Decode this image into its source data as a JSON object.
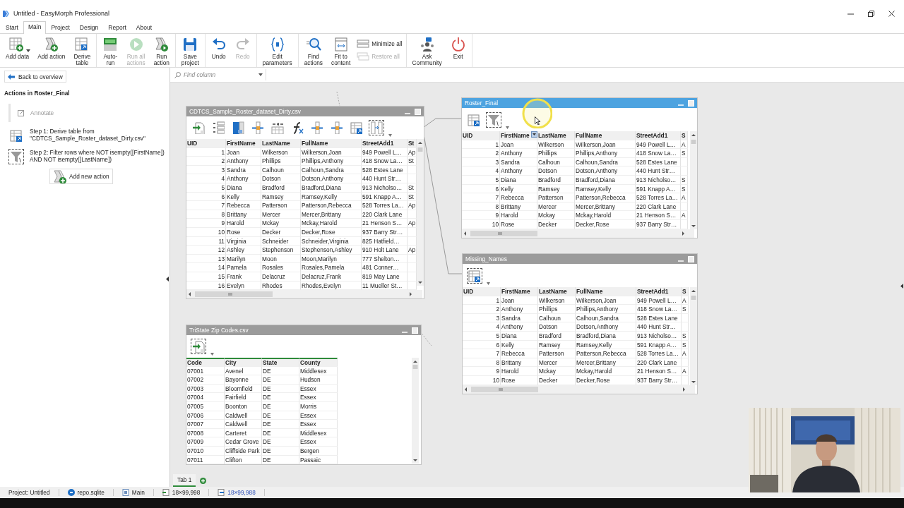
{
  "window": {
    "title": "Untitled - EasyMorph Professional"
  },
  "menu_tabs": [
    {
      "label": "Start",
      "selected": false
    },
    {
      "label": "Main",
      "selected": true
    },
    {
      "label": "Project",
      "selected": false
    },
    {
      "label": "Design",
      "selected": false
    },
    {
      "label": "Report",
      "selected": false
    },
    {
      "label": "About",
      "selected": false
    }
  ],
  "ribbon": {
    "groups": [
      {
        "buttons": [
          {
            "kind": "large",
            "label": "Add data",
            "disabled": false,
            "dropdown": true
          },
          {
            "kind": "large",
            "label": "Add action",
            "disabled": false,
            "dropdown": false
          },
          {
            "kind": "large",
            "label": "Derive\ntable",
            "disabled": false,
            "dropdown": false
          }
        ]
      },
      {
        "buttons": [
          {
            "kind": "large",
            "label": "Auto-\nrun",
            "disabled": false,
            "dropdown": false
          },
          {
            "kind": "large",
            "label": "Run all\nactions",
            "disabled": true,
            "dropdown": false
          },
          {
            "kind": "large",
            "label": "Run\naction",
            "disabled": false,
            "dropdown": false
          }
        ]
      },
      {
        "buttons": [
          {
            "kind": "large",
            "label": "Save\nproject",
            "disabled": false,
            "dropdown": false
          }
        ]
      },
      {
        "buttons": [
          {
            "kind": "large",
            "label": "Undo",
            "disabled": false,
            "dropdown": false
          },
          {
            "kind": "large",
            "label": "Redo",
            "disabled": true,
            "dropdown": false
          }
        ]
      },
      {
        "buttons": [
          {
            "kind": "large",
            "label": "Edit\nparameters",
            "disabled": false,
            "dropdown": false
          }
        ]
      },
      {
        "buttons": [
          {
            "kind": "large",
            "label": "Find\nactions",
            "disabled": false,
            "dropdown": false
          },
          {
            "kind": "large",
            "label": "Fit to\ncontent",
            "disabled": false,
            "dropdown": false
          },
          {
            "kind": "small",
            "label": "Minimize all",
            "disabled": false,
            "dropdown": false
          },
          {
            "kind": "small",
            "label": "Restore all",
            "disabled": true,
            "dropdown": false
          }
        ]
      },
      {
        "buttons": [
          {
            "kind": "large",
            "label": "Ask\nCommunity",
            "disabled": false,
            "dropdown": false
          },
          {
            "kind": "large",
            "label": "Exit",
            "disabled": false,
            "dropdown": false
          }
        ]
      }
    ]
  },
  "find_column": {
    "placeholder": "Find column"
  },
  "sidebar": {
    "back_button": "Back to overview",
    "heading": "Actions in Roster_Final",
    "annotate": {
      "label": "Annotate",
      "disabled": true
    },
    "steps": [
      {
        "kind": "derive",
        "text": "Step 1: Derive table from\n\"CDTCS_Sample_Roster_dataset_Dirty.csv\"",
        "selected": false
      },
      {
        "kind": "filter",
        "text": "Step 2: Filter rows where NOT isempty([FirstName])\nAND NOT isempty([LastName])",
        "selected": true
      }
    ],
    "add_button": "Add new action"
  },
  "tables": [
    {
      "title": "CDTCS_Sample_Roster_dataset_Dirty.csv",
      "selected": false,
      "actions": [
        {
          "kind": "import",
          "selected": false
        },
        {
          "kind": "enumerate",
          "selected": false
        },
        {
          "kind": "column",
          "selected": false
        },
        {
          "kind": "insert",
          "selected": false
        },
        {
          "kind": "merge",
          "selected": false
        },
        {
          "kind": "formula",
          "selected": false
        },
        {
          "kind": "insert",
          "selected": false
        },
        {
          "kind": "insert",
          "selected": false
        },
        {
          "kind": "derive",
          "selected": false
        },
        {
          "kind": "select",
          "selected": true
        }
      ],
      "columns": [
        "UID",
        "FirstName",
        "LastName",
        "FullName",
        "StreetAdd1",
        "St"
      ],
      "rows": [
        [
          "1",
          "Joan",
          "Wilkerson",
          "Wilkerson,Joan",
          "949 Powell L…",
          "Ap"
        ],
        [
          "2",
          "Anthony",
          "Phillips",
          "Phillips,Anthony",
          "418 Snow La…",
          "St"
        ],
        [
          "3",
          "Sandra",
          "Calhoun",
          "Calhoun,Sandra",
          "528 Estes Lane",
          null
        ],
        [
          "4",
          "Anthony",
          "Dotson",
          "Dotson,Anthony",
          "440 Hunt Str…",
          null
        ],
        [
          "5",
          "Diana",
          "Bradford",
          "Bradford,Diana",
          "913 Nicholso…",
          "St"
        ],
        [
          "6",
          "Kelly",
          "Ramsey",
          "Ramsey,Kelly",
          "591 Knapp A…",
          "St"
        ],
        [
          "7",
          "Rebecca",
          "Patterson",
          "Patterson,Rebecca",
          "528 Torres La…",
          "Ap"
        ],
        [
          "8",
          "Brittany",
          "Mercer",
          "Mercer,Brittany",
          "220 Clark Lane",
          null
        ],
        [
          "9",
          "Harold",
          "Mckay",
          "Mckay,Harold",
          "21 Henson S…",
          "Ap"
        ],
        [
          "10",
          "Rose",
          "Decker",
          "Decker,Rose",
          "937 Barry Str…",
          null
        ],
        [
          "11",
          "Virginia",
          "Schneider",
          "Schneider,Virginia",
          "825 Hatfield…",
          null
        ],
        [
          "12",
          "Ashley",
          "Stephenson",
          "Stephenson,Ashley",
          "910 Holt Lane",
          "Ap"
        ],
        [
          "13",
          "Marilyn",
          "Moon",
          "Moon,Marilyn",
          "777 Shelton…",
          null
        ],
        [
          "14",
          "Pamela",
          "Rosales",
          "Rosales,Pamela",
          "481 Conner…",
          null
        ],
        [
          "15",
          "Frank",
          "Delacruz",
          "Delacruz,Frank",
          "819 May Lane",
          null
        ],
        [
          "16",
          "Evelyn",
          "Rhodes",
          "Rhodes,Evelyn",
          "11 Mueller St…",
          null
        ]
      ]
    },
    {
      "title": "Roster_Final",
      "selected": true,
      "actions": [
        {
          "kind": "derive",
          "selected": false
        },
        {
          "kind": "filter",
          "selected": true
        }
      ],
      "columns": [
        "UID",
        "FirstName",
        "LastName",
        "FullName",
        "StreetAdd1",
        "S"
      ],
      "rows": [
        [
          "1",
          "Joan",
          "Wilkerson",
          "Wilkerson,Joan",
          "949 Powell L…",
          "A"
        ],
        [
          "2",
          "Anthony",
          "Phillips",
          "Phillips,Anthony",
          "418 Snow La…",
          "S"
        ],
        [
          "3",
          "Sandra",
          "Calhoun",
          "Calhoun,Sandra",
          "528 Estes Lane",
          null
        ],
        [
          "4",
          "Anthony",
          "Dotson",
          "Dotson,Anthony",
          "440 Hunt Str…",
          null
        ],
        [
          "5",
          "Diana",
          "Bradford",
          "Bradford,Diana",
          "913 Nicholso…",
          "S"
        ],
        [
          "6",
          "Kelly",
          "Ramsey",
          "Ramsey,Kelly",
          "591 Knapp A…",
          "S"
        ],
        [
          "7",
          "Rebecca",
          "Patterson",
          "Patterson,Rebecca",
          "528 Torres La…",
          "A"
        ],
        [
          "8",
          "Brittany",
          "Mercer",
          "Mercer,Brittany",
          "220 Clark Lane",
          null
        ],
        [
          "9",
          "Harold",
          "Mckay",
          "Mckay,Harold",
          "21 Henson S…",
          "A"
        ],
        [
          "10",
          "Rose",
          "Decker",
          "Decker,Rose",
          "937 Barry Str…",
          null
        ]
      ]
    },
    {
      "title": "Missing_Names",
      "selected": false,
      "actions": [
        {
          "kind": "derive",
          "selected": true
        }
      ],
      "columns": [
        "UID",
        "FirstName",
        "LastName",
        "FullName",
        "StreetAdd1",
        "S"
      ],
      "rows": [
        [
          "1",
          "Joan",
          "Wilkerson",
          "Wilkerson,Joan",
          "949 Powell L…",
          "A"
        ],
        [
          "2",
          "Anthony",
          "Phillips",
          "Phillips,Anthony",
          "418 Snow La…",
          "S"
        ],
        [
          "3",
          "Sandra",
          "Calhoun",
          "Calhoun,Sandra",
          "528 Estes Lane",
          null
        ],
        [
          "4",
          "Anthony",
          "Dotson",
          "Dotson,Anthony",
          "440 Hunt Str…",
          null
        ],
        [
          "5",
          "Diana",
          "Bradford",
          "Bradford,Diana",
          "913 Nicholso…",
          "S"
        ],
        [
          "6",
          "Kelly",
          "Ramsey",
          "Ramsey,Kelly",
          "591 Knapp A…",
          "S"
        ],
        [
          "7",
          "Rebecca",
          "Patterson",
          "Patterson,Rebecca",
          "528 Torres La…",
          "A"
        ],
        [
          "8",
          "Brittany",
          "Mercer",
          "Mercer,Brittany",
          "220 Clark Lane",
          null
        ],
        [
          "9",
          "Harold",
          "Mckay",
          "Mckay,Harold",
          "21 Henson S…",
          "A"
        ],
        [
          "10",
          "Rose",
          "Decker",
          "Decker,Rose",
          "937 Barry Str…",
          null
        ]
      ]
    },
    {
      "title": "TriState Zip Codes.csv",
      "selected": false,
      "actions": [
        {
          "kind": "import",
          "selected": true
        }
      ],
      "columns": [
        "Code",
        "City",
        "State",
        "County"
      ],
      "rows": [
        [
          "07001",
          "Avenel",
          "DE",
          "Middlesex"
        ],
        [
          "07002",
          "Bayonne",
          "DE",
          "Hudson"
        ],
        [
          "07003",
          "Bloomfield",
          "DE",
          "Essex"
        ],
        [
          "07004",
          "Fairfield",
          "DE",
          "Essex"
        ],
        [
          "07005",
          "Boonton",
          "DE",
          "Morris"
        ],
        [
          "07006",
          "Caldwell",
          "DE",
          "Essex"
        ],
        [
          "07007",
          "Caldwell",
          "DE",
          "Essex"
        ],
        [
          "07008",
          "Carteret",
          "DE",
          "Middlesex"
        ],
        [
          "07009",
          "Cedar Grove",
          "DE",
          "Essex"
        ],
        [
          "07010",
          "Cliffside Park",
          "DE",
          "Bergen"
        ],
        [
          "07011",
          "Clifton",
          "DE",
          "Passaic"
        ]
      ]
    }
  ],
  "canvas_tabs": [
    {
      "label": "Tab 1",
      "selected": true
    }
  ],
  "status_bar": [
    {
      "text": "Project:  Untitled",
      "link": false
    },
    {
      "text": "repo.sqlite",
      "link": false
    },
    {
      "text": "Main",
      "link": false
    },
    {
      "text": "18×99,998",
      "link": false
    },
    {
      "text": "18×99,988",
      "link": true
    }
  ]
}
